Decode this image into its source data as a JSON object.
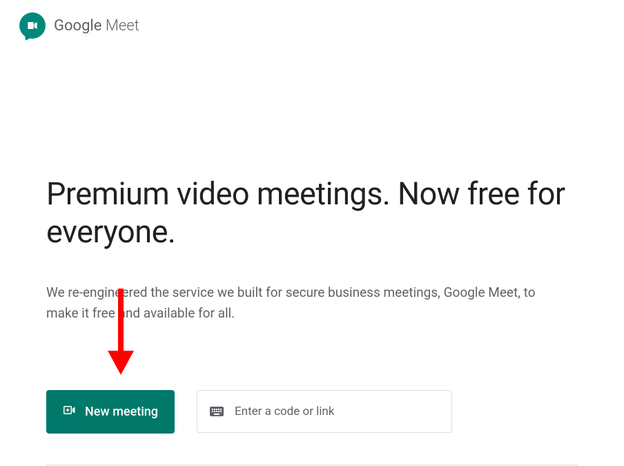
{
  "header": {
    "logo_google": "Google",
    "logo_meet": " Meet"
  },
  "main": {
    "heading": "Premium video meetings. Now free for everyone.",
    "subheading": "We re-engineered the service we built for secure business meetings, Google Meet, to make it free and available for all.",
    "new_meeting_label": "New meeting",
    "code_input_placeholder": "Enter a code or link"
  },
  "colors": {
    "brand_green": "#00897b",
    "button_green": "#00796b",
    "text_primary": "#202124",
    "text_secondary": "#5f6368",
    "border": "#dadce0",
    "annotation_red": "#ff0000"
  }
}
